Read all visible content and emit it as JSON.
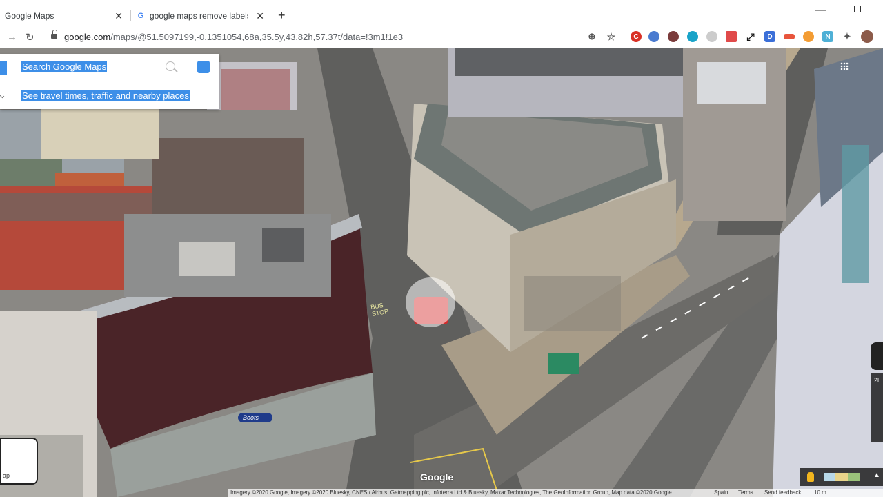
{
  "browser": {
    "tabs": [
      {
        "title": "Google Maps",
        "active": true
      },
      {
        "title": "google maps remove labels - Go",
        "active": false
      }
    ],
    "new_tab_label": "+",
    "url_main": "google.com",
    "url_rest": "/maps/@51.5097199,-0.1351054,68a,35.5y,43.82h,57.37t/data=!3m1!1e3"
  },
  "search": {
    "placeholder": "Search Google Maps",
    "travel_text": "See travel times, traffic and nearby places"
  },
  "map": {
    "overlay_text_storefront": "Boots",
    "road_text": "BUS STOP",
    "logo": "Google",
    "minimap_label": "ap",
    "right_label": "2l"
  },
  "attribution": {
    "imagery": "Imagery ©2020 Google, Imagery ©2020 Bluesky, CNES / Airbus, Getmapping plc, Infoterra Ltd & Bluesky, Maxar Technologies, The GeoInformation Group, Map data ©2020 Google",
    "country": "Spain",
    "terms": "Terms",
    "feedback": "Send feedback",
    "scale": "10 m"
  },
  "colors": {
    "highlight": "#3d8fe8",
    "accent_blue": "#4285f4"
  }
}
